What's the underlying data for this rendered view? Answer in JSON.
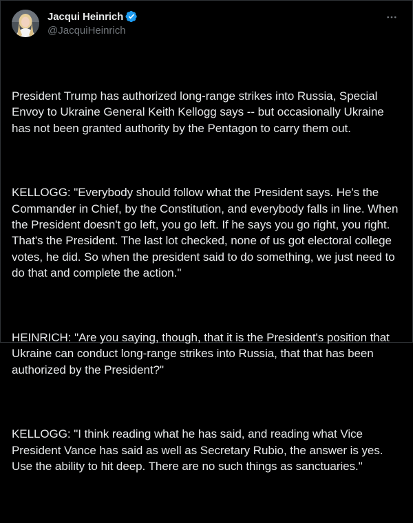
{
  "author": {
    "display_name": "Jacqui Heinrich",
    "handle": "@JacquiHeinrich",
    "verified": true,
    "avatar_icon": "profile-photo"
  },
  "menu": {
    "more_icon": "more-horizontal-icon"
  },
  "tweet": {
    "paragraphs": [
      "President Trump has authorized long-range strikes into Russia, Special Envoy to Ukraine General Keith Kellogg says -- but occasionally Ukraine has not been granted authority by the Pentagon to carry them out.",
      "KELLOGG: \"Everybody should follow what the President says. He's the Commander in Chief, by the Constitution, and everybody falls in line. When the President doesn't go left, you go left. If he says you go right, you right. That's the President. The last lot checked, none of us got electoral college votes, he did. So when the president said to do something, we just need to do that and complete the action.\"",
      "HEINRICH: \"Are you saying, though, that it is the President's position that Ukraine can conduct long-range strikes into Russia, that that has been authorized by the President?\"",
      "KELLOGG: \"I think reading what he has said, and reading what Vice President Vance has said as well as Secretary Rubio, the answer is yes. Use the ability to hit deep. There are no such things as sanctuaries.\""
    ]
  },
  "colors": {
    "background": "#000000",
    "text": "#e7e9ea",
    "secondary_text": "#71767b",
    "verified_badge": "#1d9bf0"
  }
}
